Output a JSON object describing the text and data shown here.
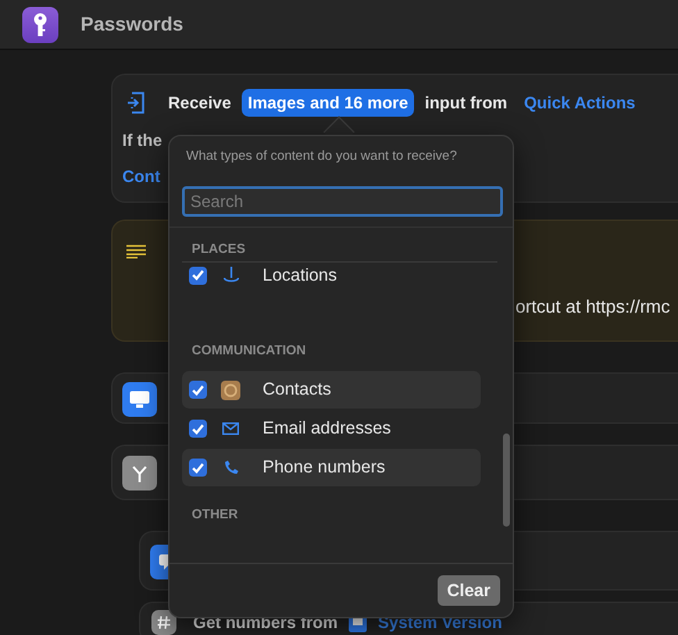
{
  "window": {
    "title": "Passwords"
  },
  "receive_action": {
    "label": "Receive",
    "types_button": "Images and 16 more",
    "connector": "input from",
    "source": "Quick Actions",
    "line_2": "If the",
    "line_3": "Cont"
  },
  "comment": {
    "text": "ortcut at https://rmc"
  },
  "bottom_action": {
    "label": "Get numbers from",
    "variable": "System Version"
  },
  "popover": {
    "prompt": "What types of content do you want to receive?",
    "search": {
      "placeholder": "Search"
    },
    "sections": [
      {
        "title": "PLACES",
        "items": [
          {
            "label": "Locations",
            "kind": "pin",
            "checked": true,
            "highlighted": false
          }
        ]
      },
      {
        "title": "COMMUNICATION",
        "items": [
          {
            "label": "Contacts",
            "kind": "contact",
            "checked": true,
            "highlighted": true
          },
          {
            "label": "Email addresses",
            "kind": "mail",
            "checked": true,
            "highlighted": false
          },
          {
            "label": "Phone numbers",
            "kind": "phone",
            "checked": true,
            "highlighted": true
          }
        ]
      },
      {
        "title": "OTHER"
      }
    ],
    "clear_button": "Clear"
  }
}
